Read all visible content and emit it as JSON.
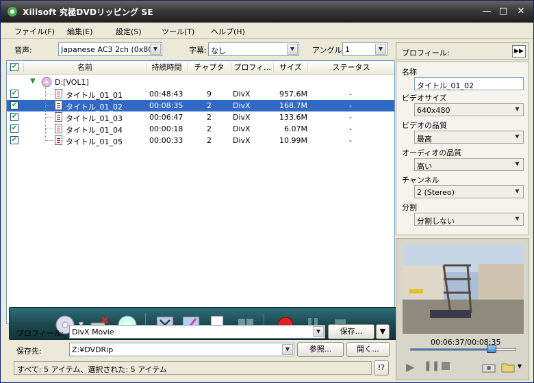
{
  "window": {
    "title": "Xilisoft 究極DVDリッピング SE"
  },
  "menu": [
    "ファイル(F)",
    "編集(E)",
    "設定(S)",
    "ツール(T)",
    "ヘルプ(H)"
  ],
  "top": {
    "audio_label": "音声:",
    "audio_value": "Japanese AC3 2ch (0x80)",
    "subtitle_label": "字幕:",
    "subtitle_value": "なし",
    "angle_label": "アングル:",
    "angle_value": "1"
  },
  "columns": [
    "名前",
    "持続時間",
    "チャプタ",
    "プロフィ...",
    "サイズ",
    "ステータス"
  ],
  "tree_root": "D:[VOL1]",
  "rows": [
    {
      "name": "タイトル_01_01",
      "duration": "00:48:43",
      "chapters": "9",
      "profile": "DivX",
      "size": "957.6M",
      "status": "-"
    },
    {
      "name": "タイトル_01_02",
      "duration": "00:08:35",
      "chapters": "2",
      "profile": "DivX",
      "size": "168.7M",
      "status": "-"
    },
    {
      "name": "タイトル_01_03",
      "duration": "00:06:47",
      "chapters": "2",
      "profile": "DivX",
      "size": "133.6M",
      "status": "-"
    },
    {
      "name": "タイトル_01_04",
      "duration": "00:00:18",
      "chapters": "2",
      "profile": "DivX",
      "size": "6.07M",
      "status": "-"
    },
    {
      "name": "タイトル_01_05",
      "duration": "00:00:33",
      "chapters": "2",
      "profile": "DivX",
      "size": "10.99M",
      "status": "-"
    }
  ],
  "bottom": {
    "profile_label": "プロフィール:",
    "profile_value": "DivX Movie",
    "save_btn": "保存...",
    "dest_label": "保存先:",
    "dest_value": "Z:¥DVDRip",
    "browse_btn": "参照...",
    "open_btn": "開く...",
    "status_text": "すべて: 5 アイテム、選択された: 5 アイテム",
    "help_btn": "!?"
  },
  "right": {
    "profile_label": "プロフィール:",
    "name_label": "名称",
    "name_value": "タイトル_01_02",
    "video_size_label": "ビデオサイズ",
    "video_size_value": "640x480",
    "video_quality_label": "ビデオの品質",
    "video_quality_value": "最高",
    "audio_quality_label": "オーディオの品質",
    "audio_quality_value": "高い",
    "channel_label": "チャンネル",
    "channel_value": "2 (Stereo)",
    "split_label": "分割",
    "split_value": "分割しない",
    "time_text": "00:06:37/00:08:35",
    "progress": 0.77
  }
}
